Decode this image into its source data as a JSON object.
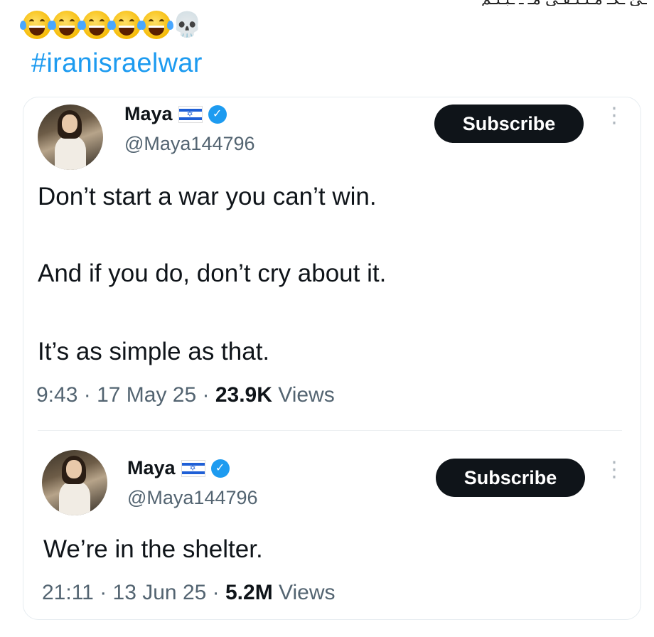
{
  "caption": {
    "cutoff_text": "ـئ ـكـ مـلـتـقـى مـ ـ ـبـئـم",
    "emojis": [
      "laughing-crying",
      "laughing-crying",
      "laughing-crying",
      "laughing-crying",
      "laughing-crying",
      "skull"
    ],
    "hashtag": "#iranisraelwar"
  },
  "tweets": [
    {
      "name": "Maya",
      "handle": "@Maya144796",
      "subscribe_label": "Subscribe",
      "lines": [
        "Don’t start a war you can’t win.",
        "And if you do, don’t cry about it.",
        "It’s as simple as that."
      ],
      "time": "9:43",
      "date": "17 May 25",
      "views_count": "23.9K",
      "views_label": "Views"
    },
    {
      "name": "Maya",
      "handle": "@Maya144796",
      "subscribe_label": "Subscribe",
      "lines": [
        "We’re in the shelter."
      ],
      "time": "21:11",
      "date": "13 Jun 25",
      "views_count": "5.2M",
      "views_label": "Views"
    }
  ],
  "colors": {
    "hashtag": "#1d9bf0",
    "verified": "#1d9bf0",
    "subscribe_bg": "#0f1419",
    "secondary_text": "#536471"
  }
}
